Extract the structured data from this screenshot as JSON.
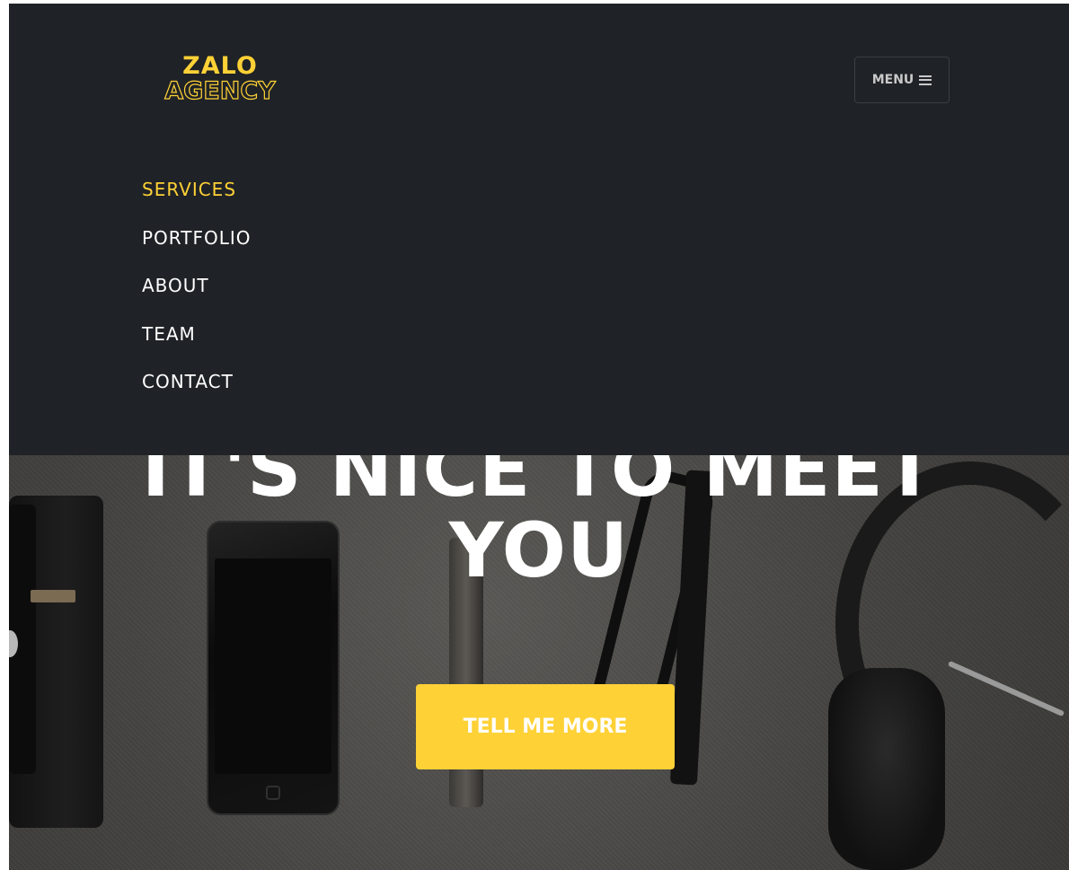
{
  "colors": {
    "accent": "#fed136",
    "navbar_bg": "#1f2226",
    "nav_text": "#ffffff",
    "menu_button_text": "#c9c9c9"
  },
  "brand": {
    "line1": "ZALO",
    "line2": "AGENCY"
  },
  "menu_button": {
    "label": "MENU",
    "icon": "hamburger-icon"
  },
  "nav": {
    "items": [
      {
        "label": "SERVICES",
        "active": true
      },
      {
        "label": "PORTFOLIO",
        "active": false
      },
      {
        "label": "ABOUT",
        "active": false
      },
      {
        "label": "TEAM",
        "active": false
      },
      {
        "label": "CONTACT",
        "active": false
      }
    ]
  },
  "hero": {
    "heading_line1": "IT'S NICE TO MEET",
    "heading_line2": "YOU",
    "cta_label": "TELL ME MORE"
  }
}
